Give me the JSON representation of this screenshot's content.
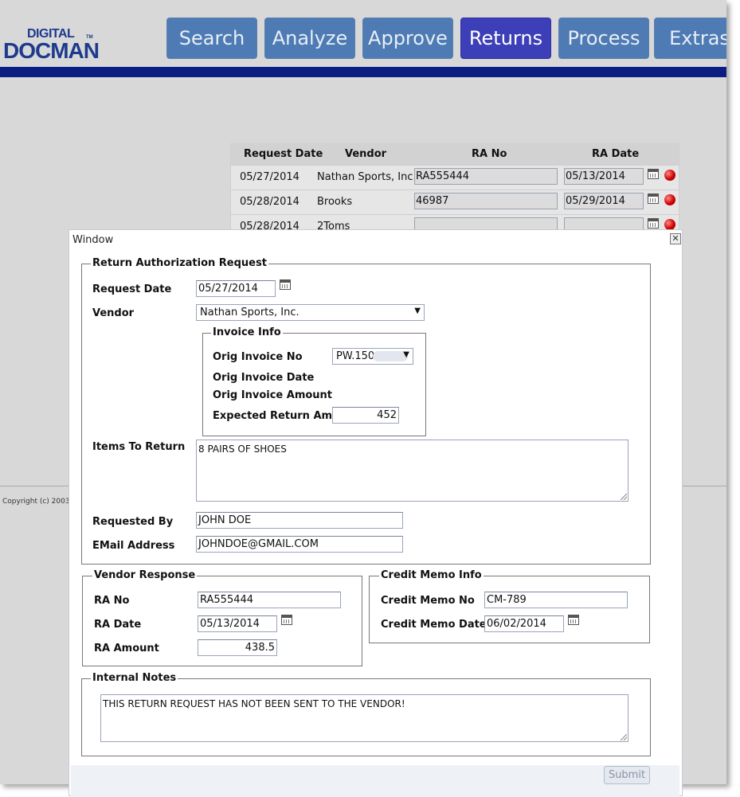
{
  "app": {
    "logo_top": "DIGITAL",
    "logo_bottom": "DOCMAN",
    "logo_tm": "TM",
    "nav": [
      "Search",
      "Analyze",
      "Approve",
      "Returns",
      "Process",
      "Extras"
    ],
    "active_nav": "Returns",
    "copyright": "Copyright (c) 2003"
  },
  "bg_table": {
    "headers": [
      "Request Date",
      "Vendor",
      "RA No",
      "RA Date"
    ],
    "rows": [
      {
        "date": "05/27/2014",
        "vendor": "Nathan Sports, Inc.",
        "ra_no": "RA555444",
        "ra_date": "05/13/2014"
      },
      {
        "date": "05/28/2014",
        "vendor": "Brooks",
        "ra_no": "46987",
        "ra_date": "05/29/2014"
      },
      {
        "date": "05/28/2014",
        "vendor": "2Toms",
        "ra_no": "",
        "ra_date": ""
      }
    ]
  },
  "window": {
    "title": "Window",
    "close": "✕",
    "ra_request": {
      "legend": "Return Authorization Request",
      "request_date_label": "Request Date",
      "request_date": "05/27/2014",
      "vendor_label": "Vendor",
      "vendor": "Nathan Sports, Inc.",
      "invoice": {
        "legend": "Invoice Info",
        "orig_invoice_no_label": "Orig Invoice No",
        "orig_invoice_no": "PW.150",
        "orig_invoice_date_label": "Orig Invoice Date",
        "orig_invoice_amount_label": "Orig Invoice Amount",
        "expected_return_label": "Expected Return Amt",
        "expected_return": "452"
      },
      "items_label": "Items To Return",
      "items": "8 PAIRS OF SHOES",
      "requested_by_label": "Requested By",
      "requested_by": "JOHN DOE",
      "email_label": "EMail Address",
      "email": "JOHNDOE@GMAIL.COM"
    },
    "vendor_response": {
      "legend": "Vendor Response",
      "ra_no_label": "RA No",
      "ra_no": "RA555444",
      "ra_date_label": "RA Date",
      "ra_date": "05/13/2014",
      "ra_amount_label": "RA Amount",
      "ra_amount": "438.5"
    },
    "credit_memo": {
      "legend": "Credit Memo Info",
      "no_label": "Credit Memo No",
      "no": "CM-789",
      "date_label": "Credit Memo Date",
      "date": "06/02/2014"
    },
    "notes": {
      "legend": "Internal Notes",
      "text": "THIS RETURN REQUEST HAS NOT BEEN SENT TO THE VENDOR!"
    },
    "submit": "Submit"
  }
}
